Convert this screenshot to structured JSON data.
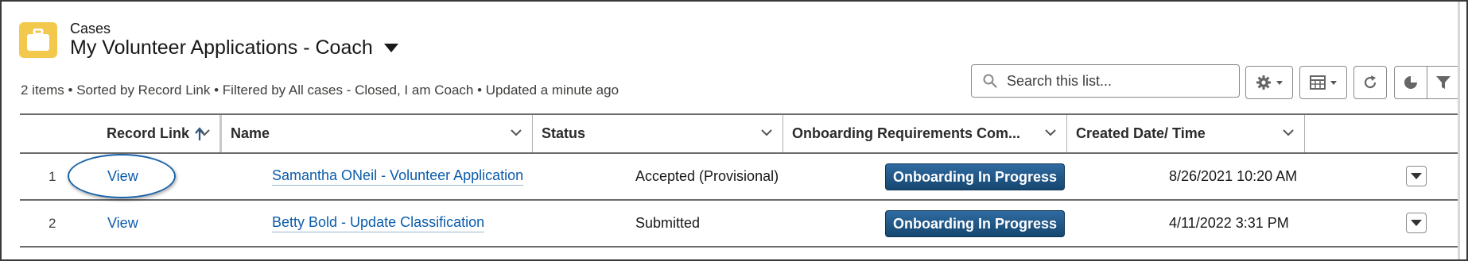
{
  "header": {
    "object_label": "Cases",
    "list_title": "My Volunteer Applications - Coach",
    "icon": "briefcase-icon",
    "meta": "2 items • Sorted by Record Link • Filtered by All cases - Closed, I am Coach • Updated a minute ago"
  },
  "search": {
    "placeholder": "Search this list..."
  },
  "toolbar": {
    "buttons": [
      "gear-icon",
      "table-icon",
      "refresh-icon",
      "chart-icon",
      "filter-icon"
    ]
  },
  "table": {
    "columns": [
      {
        "label": "Record Link",
        "sorted": "ascending"
      },
      {
        "label": "Name"
      },
      {
        "label": "Status"
      },
      {
        "label": "Onboarding Requirements Com..."
      },
      {
        "label": "Created Date/ Time"
      }
    ],
    "rows": [
      {
        "num": "1",
        "record_link": "View",
        "name": "Samantha ONeil - Volunteer Application",
        "status": "Accepted (Provisional)",
        "onboarding": "Onboarding In Progress",
        "created": "8/26/2021 10:20 AM"
      },
      {
        "num": "2",
        "record_link": "View",
        "name": "Betty Bold - Update Classification",
        "status": "Submitted",
        "onboarding": "Onboarding In Progress",
        "created": "4/11/2022 3:31 PM"
      }
    ]
  },
  "colors": {
    "accent": "#0b5cab",
    "badge": "#1d5488",
    "object_icon": "#f2c94c"
  }
}
